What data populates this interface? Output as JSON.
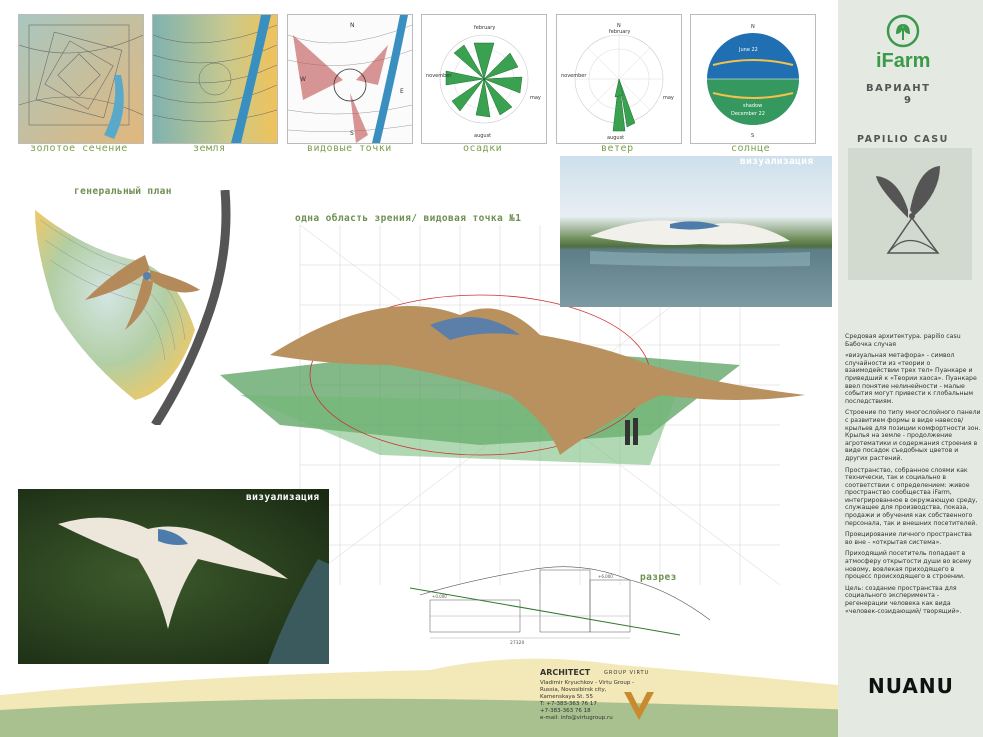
{
  "thumbnails": [
    {
      "caption": "золотое сечение"
    },
    {
      "caption": "земля"
    },
    {
      "caption": "видовые точки"
    },
    {
      "caption": "осадки"
    },
    {
      "caption": "ветер"
    },
    {
      "caption": "солнце"
    }
  ],
  "rose_labels": {
    "precip": {
      "top": "february",
      "left": "november",
      "right": "may",
      "bottom": "august"
    },
    "wind": {
      "top": "february",
      "left": "november",
      "right": "may",
      "bottom": "august",
      "n": "N",
      "s": "S"
    },
    "sun": {
      "n": "N",
      "s": "S",
      "top": "June 22",
      "bottom": "December 22",
      "mid": "shadow"
    }
  },
  "view_marks": {
    "n": "N",
    "w": "W",
    "e": "E",
    "s": "S"
  },
  "titles": {
    "general_plan": "генеральный план",
    "view_point": "одна область зрения/ видовая точка №1",
    "visualization_top": "визуализация",
    "visualization_bottom": "визуализация",
    "section": "разрез"
  },
  "brand": {
    "logo_text": "iFarm",
    "variant": "ВАРИАНТ",
    "variant_num": "9",
    "project": "PAPILIO CASU",
    "signature": "NUANU"
  },
  "description": [
    "Средовая архитектура. papilio casu Бабочка случая",
    "«визуальная метафора» - символ случайности из «теории о взаимодействии трех тел» Пуанкаре и приведший к «Теории хаоса». Пуанкаре ввел понятие нелинейности - малые события могут привести к глобальным последствиям.",
    "Строение по типу многослойного панели с развитием формы в виде навесов/крыльев для позиции комфортности зон. Крылья на земле - продолжение агротематики и содержания строения в виде посадок съедобных цветов и других растений.",
    "Пространство, собранное слоями как технически, так и социально в соответствии с определением: живое пространство сообщества iFarm, интегрированное в окружающую среду, служащее для производства, показа, продажи и обучения как собственного персонала, так и внешних посетителей.",
    "Проецирование личного пространства во вне - «открытая система».",
    "Приходящий посетитель попадает в атмосферу открытости души во всему новому, вовлекая приходящего в процесс происходящего в строении.",
    "Цель: создание пространства для социального эксперимента - регенерации человека как вида «человек-созидающий/ творящий»."
  ],
  "section_dims": {
    "width": "27320",
    "left_level": "+0.000",
    "right_level": "+6.000"
  },
  "footer": {
    "architect": "ARCHITECT",
    "group": "GROUP VIRTU",
    "contact_lines": [
      "Vladimir Kryuchkov - Virtu Group -",
      "Russia, Novosibirsk city,",
      "Kamenskaya St. 55",
      "T: +7-383-363 76 17",
      "+7-383-363 76 18",
      "e-mail: info@virtugroup.ru"
    ]
  },
  "colors": {
    "accent_green": "#7aa04a",
    "panel_bg": "#e4e9e2",
    "brand_dark": "#444444"
  }
}
